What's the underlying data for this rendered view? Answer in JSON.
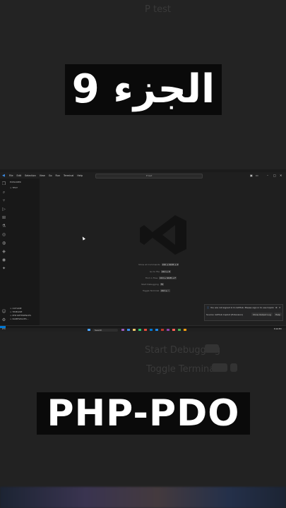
{
  "overlay": {
    "arabic_title": "الجزء 9",
    "bottom_title": "PHP-PDO"
  },
  "background_blur": {
    "top_text": "P test",
    "bottom_items": [
      "Start Debugging",
      "Toggle Terminal"
    ]
  },
  "vscode": {
    "menu": [
      "File",
      "Edit",
      "Selection",
      "View",
      "Go",
      "Run",
      "Terminal",
      "Help"
    ],
    "search_placeholder": "P test",
    "explorer_title": "EXPLORER",
    "explorer_folder": "> TEST",
    "sidebar_bottom": [
      "> OUTLINE",
      "> TIMELINE",
      "> PHP REFERENCES",
      "> NAMESPACES..."
    ],
    "shortcuts": [
      {
        "label": "Show All Commands",
        "keys": "Ctrl + Shift + P"
      },
      {
        "label": "Go to File",
        "keys": "Ctrl + P"
      },
      {
        "label": "Find in Files",
        "keys": "Ctrl + Shift + F"
      },
      {
        "label": "Start Debugging",
        "keys": "F5"
      },
      {
        "label": "Toggle Terminal",
        "keys": "Ctrl + `"
      }
    ],
    "notification": {
      "message": "You are not signed in to GitHub. Please sign in to use Copilot.",
      "source": "Source: GitHub Copilot (Extension)",
      "btn_output": "Show Output Log",
      "btn_help": "Help"
    },
    "taskbar_search": "Search",
    "weather": "9°C",
    "clock": "8:16 PM"
  }
}
